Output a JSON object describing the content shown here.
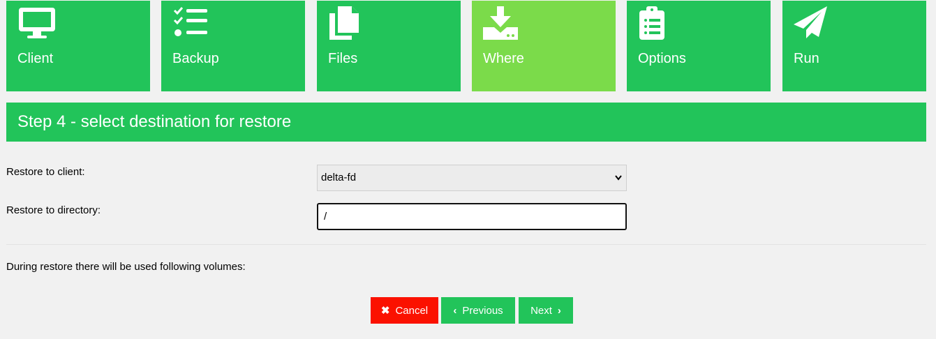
{
  "steps": [
    {
      "label": "Client",
      "icon": "monitor-icon"
    },
    {
      "label": "Backup",
      "icon": "checklist-icon"
    },
    {
      "label": "Files",
      "icon": "files-icon"
    },
    {
      "label": "Where",
      "icon": "download-drive-icon",
      "active": true
    },
    {
      "label": "Options",
      "icon": "clipboard-list-icon"
    },
    {
      "label": "Run",
      "icon": "paper-plane-icon"
    }
  ],
  "title": "Step 4 - select destination for restore",
  "form": {
    "client_label": "Restore to client:",
    "client_value": "delta-fd",
    "directory_label": "Restore to directory:",
    "directory_value": "/"
  },
  "volumes_note": "During restore there will be used following volumes:",
  "buttons": {
    "cancel": "Cancel",
    "previous": "Previous",
    "next": "Next"
  },
  "colors": {
    "primary": "#22c45a",
    "active": "#7bdb4a",
    "danger": "#fb1100",
    "background": "#f1f1f1"
  }
}
